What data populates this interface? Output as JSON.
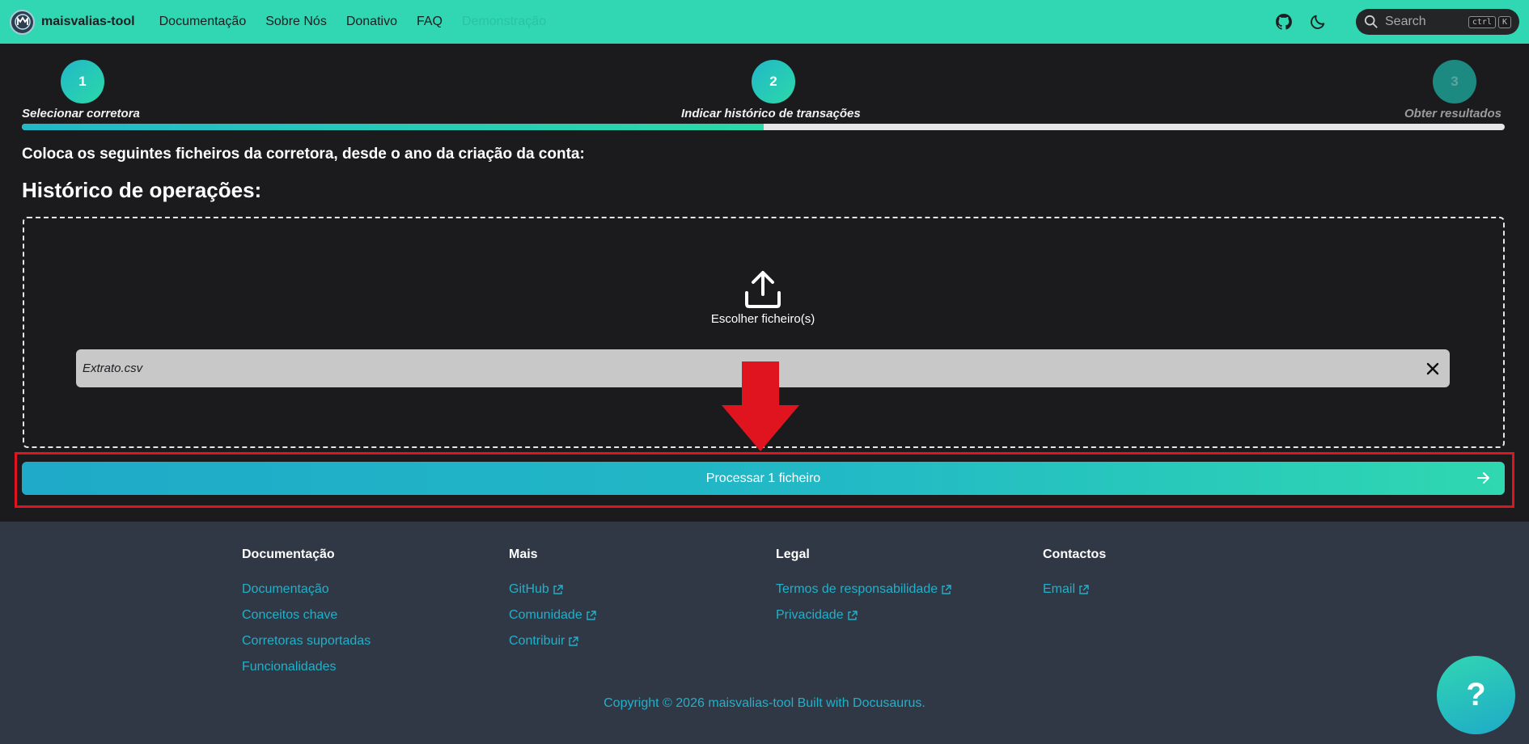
{
  "navbar": {
    "brand": "maisvalias-tool",
    "links": [
      "Documentação",
      "Sobre Nós",
      "Donativo",
      "FAQ",
      "Demonstração"
    ],
    "search_label": "Search",
    "search_kbd": [
      "ctrl",
      "K"
    ]
  },
  "stepper": {
    "steps": [
      {
        "number": "1",
        "label": "Selecionar corretora",
        "state": "done"
      },
      {
        "number": "2",
        "label": "Indicar histórico de transações",
        "state": "current"
      },
      {
        "number": "3",
        "label": "Obter resultados",
        "state": "pending"
      }
    ],
    "progress": 0.5
  },
  "main": {
    "intro": "Coloca os seguintes ficheiros da corretora, desde o ano da criação da conta:",
    "section_title": "Histórico de operações:",
    "upload_label": "Escolher ficheiro(s)",
    "file_name": "Extrato.csv",
    "process_button": "Processar 1 ficheiro"
  },
  "footer": {
    "columns": [
      {
        "title": "Documentação",
        "links": [
          "Documentação",
          "Conceitos chave",
          "Corretoras suportadas",
          "Funcionalidades"
        ]
      },
      {
        "title": "Mais",
        "links": [
          "GitHub",
          "Comunidade",
          "Contribuir"
        ]
      },
      {
        "title": "Legal",
        "links": [
          "Termos de responsabilidade",
          "Privacidade"
        ]
      },
      {
        "title": "Contactos",
        "links": [
          "Email"
        ]
      }
    ],
    "copyright": "Copyright © 2026 maisvalias-tool Built with Docusaurus."
  },
  "help_button": "?",
  "colors": {
    "accent": "#31d6b2",
    "link": "#21b0c9",
    "highlight": "#e0141e"
  }
}
